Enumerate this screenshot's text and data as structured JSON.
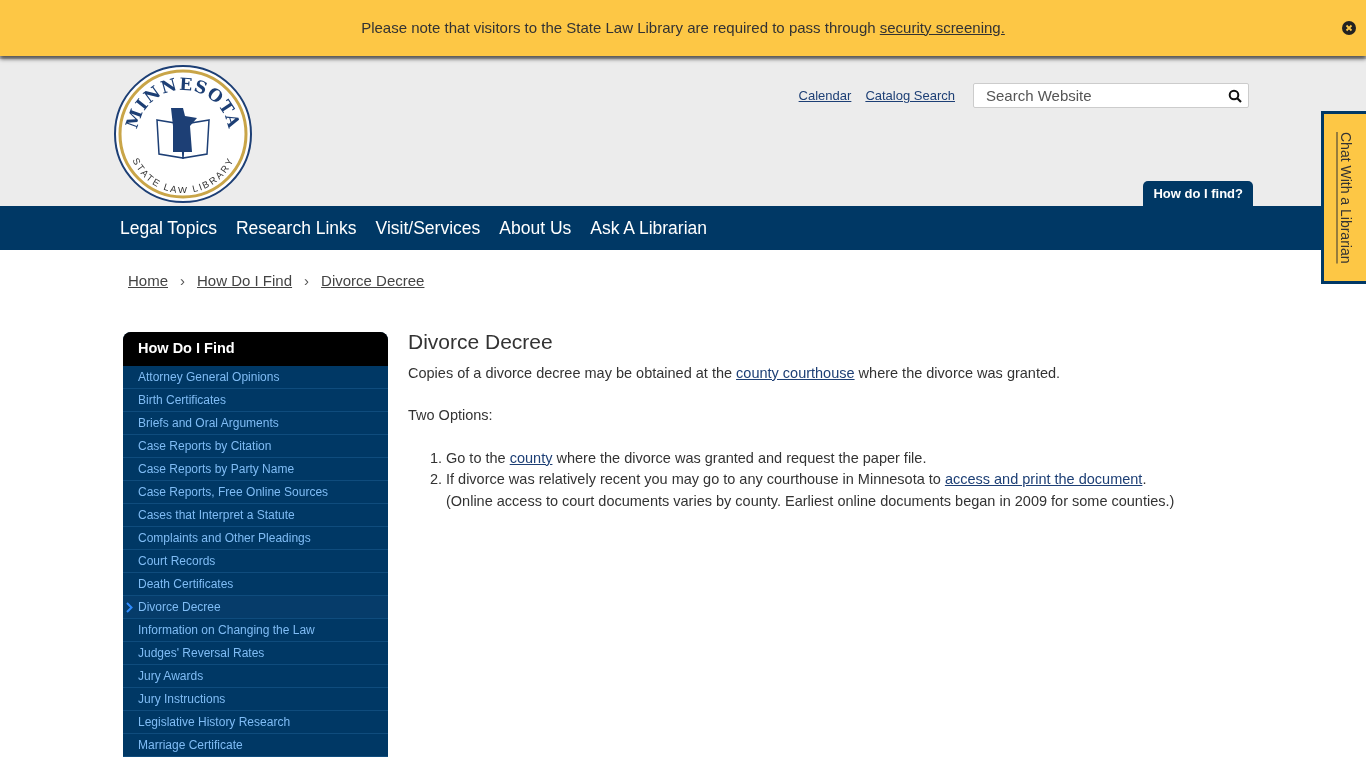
{
  "banner": {
    "segments": [
      {
        "text": "Please note that visitors to the State Law Library are required to pass through "
      },
      {
        "text": "security screening. ",
        "link": true
      }
    ]
  },
  "logo": {
    "top": "MINNESOTA",
    "bottom": "STATE LAW LIBRARY"
  },
  "utility_links": [
    "Calendar",
    "Catalog Search"
  ],
  "search": {
    "placeholder": "Search Website"
  },
  "header_tab": "How do I find?",
  "nav": [
    "Legal Topics",
    "Research Links",
    "Visit/Services",
    "About Us",
    "Ask A Librarian"
  ],
  "chat_tab": "Chat With a Librarian",
  "breadcrumb": [
    {
      "label": "Home",
      "separator": "›"
    },
    {
      "label": "How Do I Find",
      "separator": "›"
    },
    {
      "label": "Divorce Decree"
    }
  ],
  "sidebar": {
    "title": "How Do I Find",
    "items": [
      {
        "label": "Attorney General Opinions",
        "selected": false
      },
      {
        "label": "Birth Certificates",
        "selected": false
      },
      {
        "label": "Briefs and Oral Arguments",
        "selected": false
      },
      {
        "label": "Case Reports by Citation",
        "selected": false
      },
      {
        "label": "Case Reports by Party Name",
        "selected": false
      },
      {
        "label": "Case Reports, Free Online Sources",
        "selected": false
      },
      {
        "label": "Cases that Interpret a Statute",
        "selected": false
      },
      {
        "label": "Complaints and Other Pleadings",
        "selected": false
      },
      {
        "label": "Court Records",
        "selected": false
      },
      {
        "label": "Death Certificates",
        "selected": false
      },
      {
        "label": "Divorce Decree",
        "selected": true
      },
      {
        "label": "Information on Changing the Law",
        "selected": false
      },
      {
        "label": "Judges' Reversal Rates",
        "selected": false
      },
      {
        "label": "Jury Awards",
        "selected": false
      },
      {
        "label": "Jury Instructions",
        "selected": false
      },
      {
        "label": "Legislative History Research",
        "selected": false
      },
      {
        "label": "Marriage Certificate",
        "selected": false
      }
    ]
  },
  "article": {
    "title": "Divorce Decree",
    "intro": [
      {
        "text": "Copies of a divorce decree may be obtained at the "
      },
      {
        "text": "county courthouse",
        "link": true
      },
      {
        "text": " where the divorce was granted."
      }
    ],
    "options_label": "Two Options:",
    "options": [
      {
        "number": "1.",
        "segments": [
          {
            "text": "Go to the "
          },
          {
            "text": "county",
            "link": true
          },
          {
            "text": " where the divorce was granted and request the paper file."
          }
        ]
      },
      {
        "number": "2.",
        "segments": [
          {
            "text": "If divorce was relatively recent you may go to any courthouse in Minnesota to "
          },
          {
            "text": "access and print the document",
            "link": true
          },
          {
            "text": "."
          }
        ],
        "note": "(Online access to court documents varies by county. Earliest online documents began in 2009 for some counties.)"
      }
    ]
  }
}
